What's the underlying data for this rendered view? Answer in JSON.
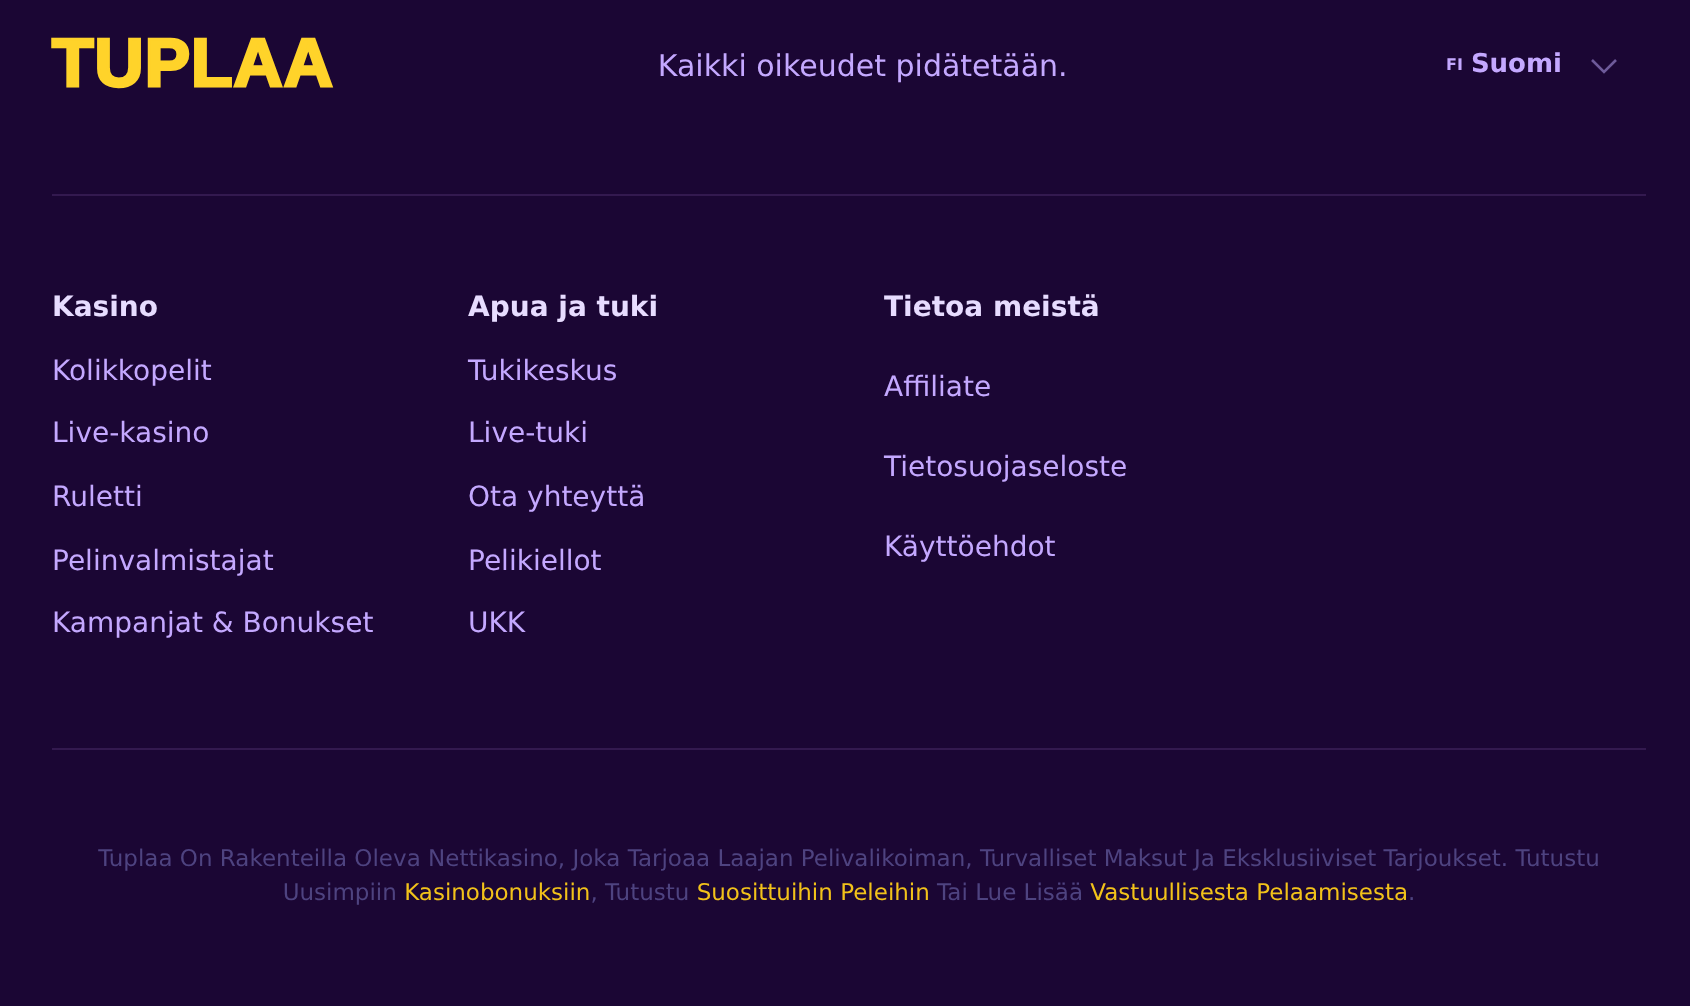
{
  "header": {
    "logo": "TUPLAA",
    "copyright": "Kaikki oikeudet pidätetään.",
    "language": {
      "code": "FI",
      "name": "Suomi"
    }
  },
  "columns": [
    {
      "heading": "Kasino",
      "links": [
        "Kolikkopelit",
        "Live-kasino",
        "Ruletti",
        "Pelinvalmistajat",
        "Kampanjat & Bonukset"
      ]
    },
    {
      "heading": "Apua ja tuki",
      "links": [
        "Tukikeskus",
        "Live-tuki",
        "Ota yhteyttä",
        "Pelikiellot",
        "UKK"
      ]
    },
    {
      "heading": "Tietoa meistä",
      "links": [
        "Affiliate",
        "Tietosuojaseloste",
        "Käyttöehdot"
      ]
    }
  ],
  "description": [
    {
      "kind": "text",
      "text": "Tuplaa On Rakenteilla Oleva Nettikasino, Joka Tarjoaa Laajan Pelivalikoiman, Turvalliset Maksut Ja Eksklusiiviset Tarjoukset. Tutustu Uusimpiin "
    },
    {
      "kind": "link",
      "text": "Kasinobonuksiin"
    },
    {
      "kind": "text",
      "text": ", Tutustu "
    },
    {
      "kind": "link",
      "text": "Suosittuihin Peleihin"
    },
    {
      "kind": "text",
      "text": " Tai Lue Lisää "
    },
    {
      "kind": "link",
      "text": "Vastuullisesta Pelaamisesta"
    },
    {
      "kind": "text",
      "text": "."
    }
  ]
}
